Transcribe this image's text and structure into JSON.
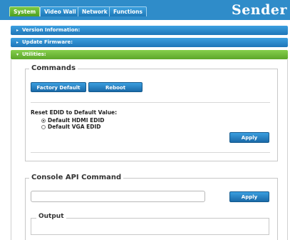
{
  "header": {
    "tabs": [
      {
        "label": "System",
        "active": true
      },
      {
        "label": "Video Wall",
        "active": false
      },
      {
        "label": "Network",
        "active": false
      },
      {
        "label": "Functions",
        "active": false
      }
    ],
    "brand": "Sender"
  },
  "sections": [
    {
      "label": "Version Information:",
      "expanded": false
    },
    {
      "label": "Update Firmware:",
      "expanded": false
    },
    {
      "label": "Utilities:",
      "expanded": true
    }
  ],
  "commands": {
    "title": "Commands",
    "factory_default_label": "Factory Default",
    "reboot_label": "Reboot",
    "edid_label": "Reset EDID to Default Value:",
    "edid_options": [
      {
        "label": "Default HDMI EDID",
        "selected": true
      },
      {
        "label": "Default VGA EDID",
        "selected": false
      }
    ],
    "apply_label": "Apply"
  },
  "console": {
    "title": "Console API Command",
    "input_value": "",
    "apply_label": "Apply",
    "output_title": "Output"
  },
  "colors": {
    "top_bar": "#2f8cc9",
    "active_tab": "#5ca62a",
    "section_blue": "#1f76b8",
    "section_green": "#5ca62a"
  }
}
